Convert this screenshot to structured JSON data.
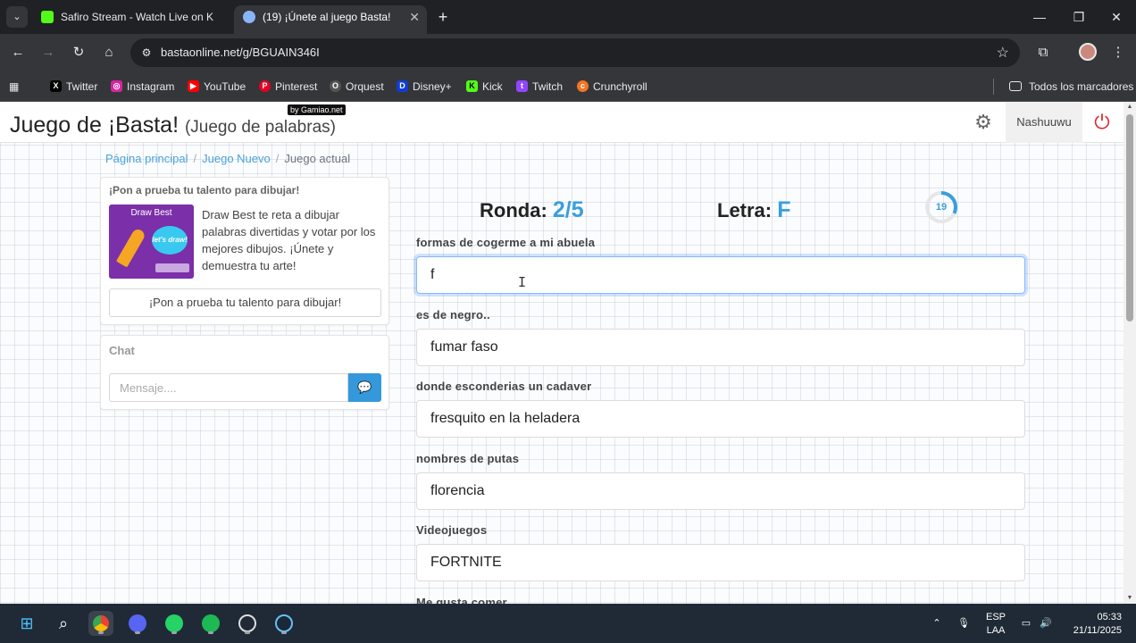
{
  "browser": {
    "tabs": [
      {
        "label": "Safiro Stream - Watch Live on K"
      },
      {
        "label": "(19) ¡Únete al juego Basta!"
      }
    ],
    "url": "bastaonline.net/g/BGUAIN346I",
    "bookmarks": [
      "Twitter",
      "Instagram",
      "YouTube",
      "Pinterest",
      "Orquest",
      "Disney+",
      "Kick",
      "Twitch",
      "Crunchyroll"
    ],
    "all_bookmarks": "Todos los marcadores"
  },
  "site": {
    "title": "Juego de ¡Basta!",
    "subtitle": "(Juego de palabras)",
    "badge": "by Gamiao.net",
    "username": "Nashuuwu"
  },
  "breadcrumb": [
    "Página principal",
    "Juego Nuevo",
    "Juego actual"
  ],
  "promo": {
    "heading": "¡Pon a prueba tu talento para dibujar!",
    "image_title": "Draw Best",
    "image_bubble": "let's draw!",
    "description": "Draw Best te reta a dibujar palabras divertidas y votar por los mejores dibujos. ¡Únete y demuestra tu arte!",
    "button": "¡Pon a prueba tu talento para dibujar!"
  },
  "chat": {
    "heading": "Chat",
    "placeholder": "Mensaje...."
  },
  "game": {
    "round_label": "Ronda:",
    "round_value": "2/5",
    "letter_label": "Letra:",
    "letter_value": "F",
    "timer": "19",
    "timer_fraction": 0.32
  },
  "fields": [
    {
      "label": "formas de cogerme a mi abuela",
      "value": "f"
    },
    {
      "label": "es de negro..",
      "value": "fumar faso"
    },
    {
      "label": "donde esconderias un cadaver",
      "value": "fresquito en la heladera"
    },
    {
      "label": "nombres de putas",
      "value": "florencia"
    },
    {
      "label": "Videojuegos",
      "value": "FORTNITE"
    },
    {
      "label": "Me gusta comer",
      "value": ""
    }
  ],
  "system": {
    "lang1": "ESP",
    "lang2": "LAA",
    "time": "05:33",
    "date": "21/11/2025"
  },
  "colors": {
    "accent": "#3a9fdc",
    "power": "#e0282e",
    "kick": "#53fc18"
  }
}
